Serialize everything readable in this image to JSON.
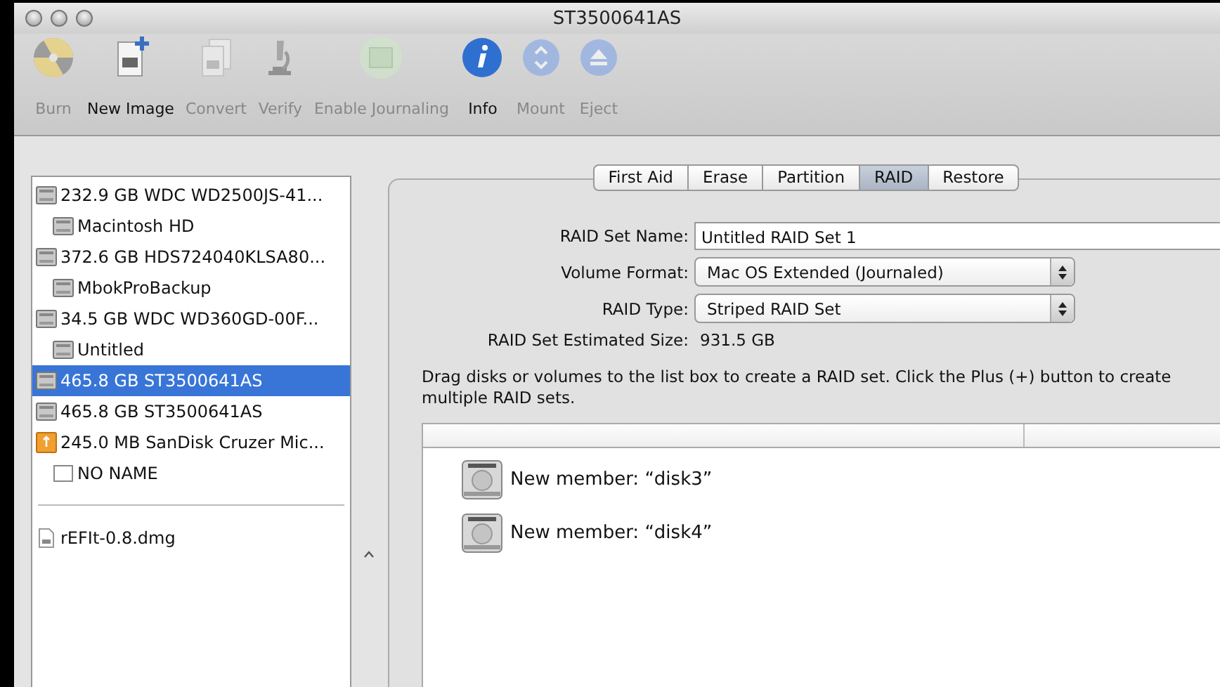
{
  "window": {
    "title": "ST3500641AS"
  },
  "toolbar": [
    {
      "kind": "burn",
      "label": "Burn",
      "disabled": true
    },
    {
      "kind": "new-image",
      "label": "New Image",
      "disabled": false
    },
    {
      "kind": "convert",
      "label": "Convert",
      "disabled": true
    },
    {
      "kind": "verify",
      "label": "Verify",
      "disabled": true
    },
    {
      "kind": "journaling",
      "label": "Enable Journaling",
      "disabled": true
    },
    {
      "kind": "info",
      "label": "Info",
      "disabled": false
    },
    {
      "kind": "mount",
      "label": "Mount",
      "disabled": true
    },
    {
      "kind": "eject",
      "label": "Eject",
      "disabled": true
    }
  ],
  "sidebar": {
    "devices": [
      {
        "kind": "disk",
        "label": "232.9 GB WDC WD2500JS-41...",
        "selected": false,
        "children": [
          {
            "kind": "disk",
            "label": "Macintosh HD",
            "selected": false
          }
        ]
      },
      {
        "kind": "disk",
        "label": "372.6 GB HDS724040KLSA80...",
        "selected": false,
        "children": [
          {
            "kind": "disk",
            "label": "MbokProBackup",
            "selected": false
          }
        ]
      },
      {
        "kind": "disk",
        "label": "34.5 GB WDC WD360GD-00F...",
        "selected": false,
        "children": [
          {
            "kind": "disk",
            "label": "Untitled",
            "selected": false
          }
        ]
      },
      {
        "kind": "disk",
        "label": "465.8 GB ST3500641AS",
        "selected": true
      },
      {
        "kind": "disk",
        "label": "465.8 GB ST3500641AS",
        "selected": false
      },
      {
        "kind": "usb",
        "label": "245.0 MB SanDisk Cruzer Mic...",
        "selected": false,
        "children": [
          {
            "kind": "blank",
            "label": "NO NAME",
            "selected": false
          }
        ]
      }
    ],
    "images": [
      {
        "kind": "dmg",
        "label": "rEFIt-0.8.dmg",
        "selected": false
      }
    ]
  },
  "tabs": [
    {
      "label": "First Aid",
      "selected": false
    },
    {
      "label": "Erase",
      "selected": false
    },
    {
      "label": "Partition",
      "selected": false
    },
    {
      "label": "RAID",
      "selected": true
    },
    {
      "label": "Restore",
      "selected": false
    }
  ],
  "form": [
    {
      "kind": "text",
      "label": "RAID Set Name:",
      "value": "Untitled RAID Set 1"
    },
    {
      "kind": "popup",
      "label": "Volume Format:",
      "value": "Mac OS Extended (Journaled)"
    },
    {
      "kind": "popup",
      "label": "RAID Type:",
      "value": "Striped RAID Set"
    },
    {
      "kind": "info",
      "label": "RAID Set Estimated Size:",
      "value": "931.5 GB"
    }
  ],
  "instructions": "Drag disks or volumes to the list box to create a RAID set. Click the Plus (+) button to create multiple RAID sets.",
  "members": [
    {
      "label": "New member: “disk3”"
    },
    {
      "label": "New member: “disk4”"
    }
  ]
}
